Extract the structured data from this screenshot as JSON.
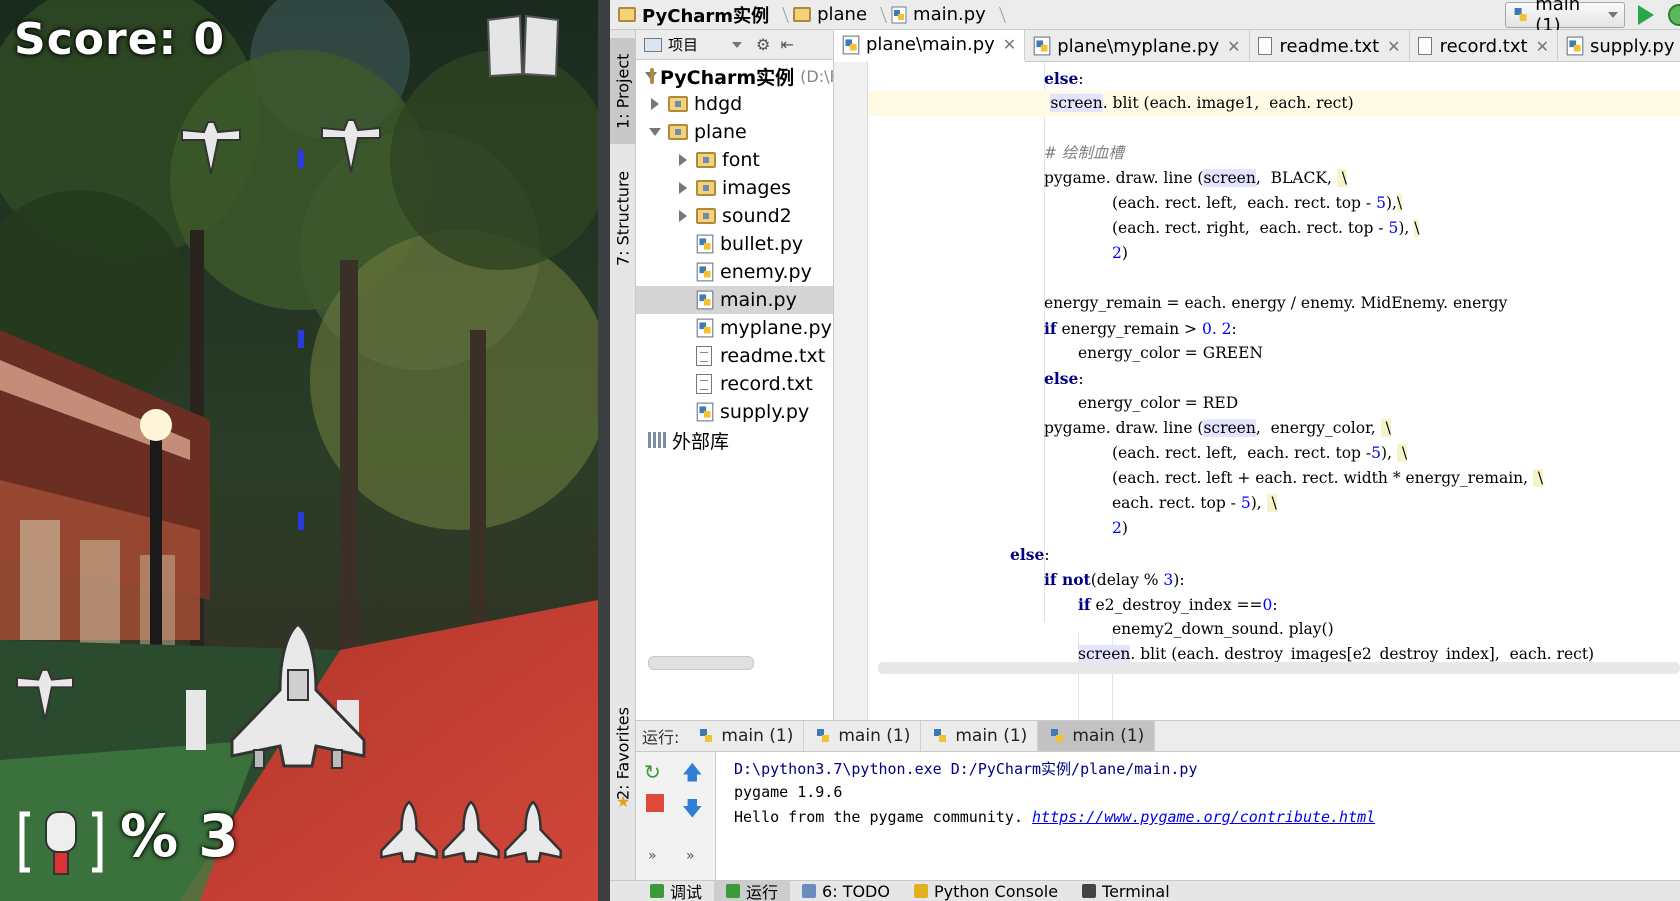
{
  "game": {
    "score_text": "Score: 0",
    "bomb_count_text": "% 3",
    "lives": 3,
    "pause_icon": "pause-icon",
    "bomb_icon": "bomb-icon"
  },
  "ide": {
    "breadcrumbs": [
      "PyCharm实例",
      "plane",
      "main.py"
    ],
    "run_config": "main (1)",
    "tool_strip": {
      "project_tab": "1: Project",
      "structure_tab": "7: Structure",
      "favorites_tab": "2: Favorites"
    },
    "project_panel": {
      "header": "项目",
      "root_name": "PyCharm实例",
      "root_path": "(D:\\P",
      "tree": [
        {
          "label": "hdgd",
          "type": "folder",
          "expanded": false,
          "depth": 1
        },
        {
          "label": "plane",
          "type": "folder",
          "expanded": true,
          "depth": 1
        },
        {
          "label": "font",
          "type": "folder",
          "expanded": false,
          "depth": 2
        },
        {
          "label": "images",
          "type": "folder",
          "expanded": false,
          "depth": 2
        },
        {
          "label": "sound2",
          "type": "folder",
          "expanded": false,
          "depth": 2
        },
        {
          "label": "bullet.py",
          "type": "py",
          "depth": 2
        },
        {
          "label": "enemy.py",
          "type": "py",
          "depth": 2
        },
        {
          "label": "main.py",
          "type": "py",
          "depth": 2,
          "selected": true
        },
        {
          "label": "myplane.py",
          "type": "py",
          "depth": 2
        },
        {
          "label": "readme.txt",
          "type": "txt",
          "depth": 2
        },
        {
          "label": "record.txt",
          "type": "txt",
          "depth": 2
        },
        {
          "label": "supply.py",
          "type": "py",
          "depth": 2
        }
      ],
      "external_libs": "外部库"
    },
    "editor_tabs": [
      {
        "label": "plane\\main.py",
        "type": "py",
        "active": true
      },
      {
        "label": "plane\\myplane.py",
        "type": "py"
      },
      {
        "label": "readme.txt",
        "type": "txt"
      },
      {
        "label": "record.txt",
        "type": "txt"
      },
      {
        "label": "supply.py",
        "type": "py"
      }
    ],
    "run_panel": {
      "label": "运行:",
      "tabs": [
        "main (1)",
        "main (1)",
        "main (1)",
        "main (1)"
      ],
      "console": {
        "line1": "D:\\python3.7\\python.exe D:/PyCharm实例/plane/main.py",
        "line2": "pygame 1.9.6",
        "line3_text": "Hello from the pygame community. ",
        "line3_link": "https://www.pygame.org/contribute.html"
      }
    },
    "bottom_tabs": [
      "调试",
      "运行",
      "6: TODO",
      "Python Console",
      "Terminal"
    ]
  },
  "colors": {
    "keyword": "#000080",
    "number": "#0000ff",
    "comment": "#808080",
    "run_green": "#28a745"
  }
}
